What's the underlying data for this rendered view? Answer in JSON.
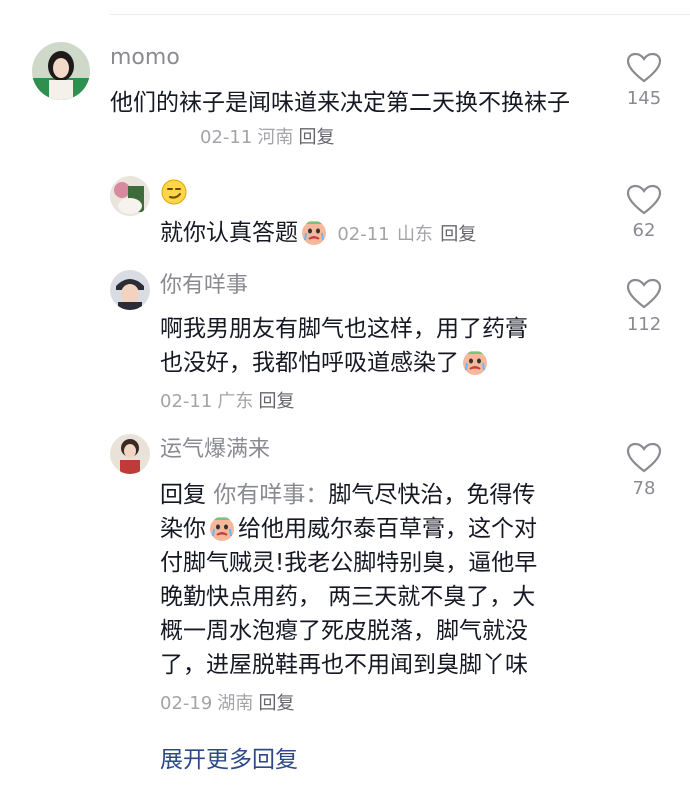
{
  "comments": [
    {
      "name": "momo",
      "text": "他们的袜子是闻味道来决定第二天换不换袜子",
      "date": "02-11",
      "location": "河南",
      "reply_label": "回复",
      "likes": "145",
      "avatar_icon": "avatar-photo-icon"
    },
    {
      "name": "",
      "name_emoji": "smirk-emoji-icon",
      "text": "就你认真答题",
      "text_emoji": "crying-face-emoji-icon",
      "date": "02-11",
      "location": "山东",
      "reply_label": "回复",
      "likes": "62",
      "avatar_icon": "avatar-photo-icon"
    },
    {
      "name": "你有咩事",
      "text_line1": "啊我男朋友有脚气也这样，用了药膏",
      "text_line2": "也没好，我都怕呼吸道感染了",
      "text_emoji": "crying-face-emoji-icon",
      "date": "02-11",
      "location": "广东",
      "reply_label": "回复",
      "likes": "112",
      "avatar_icon": "avatar-photo-icon"
    },
    {
      "name": "运气爆满来",
      "reply_prefix": "回复",
      "reply_to": "你有咩事：",
      "text_part1": "脚气尽快治，免得传",
      "text_part2": "染你",
      "text_emoji": "crying-face-emoji-icon",
      "text_part3": "给他用威尔泰百草膏，这个对",
      "text_line3": "付脚气贼灵!我老公脚特别臭，逼他早",
      "text_line4": "晚勤快点用药， 两三天就不臭了，大",
      "text_line5": "概一周水泡瘪了死皮脱落，脚气就没",
      "text_line6": "了，进屋脱鞋再也不用闻到臭脚丫味",
      "date": "02-19",
      "location": "湖南",
      "reply_label": "回复",
      "likes": "78",
      "avatar_icon": "avatar-photo-icon"
    }
  ],
  "expand_label": "展开更多回复",
  "colors": {
    "text": "#161823",
    "meta": "#a3a4a8",
    "name": "#8a8b91",
    "link": "#2e4a86"
  }
}
